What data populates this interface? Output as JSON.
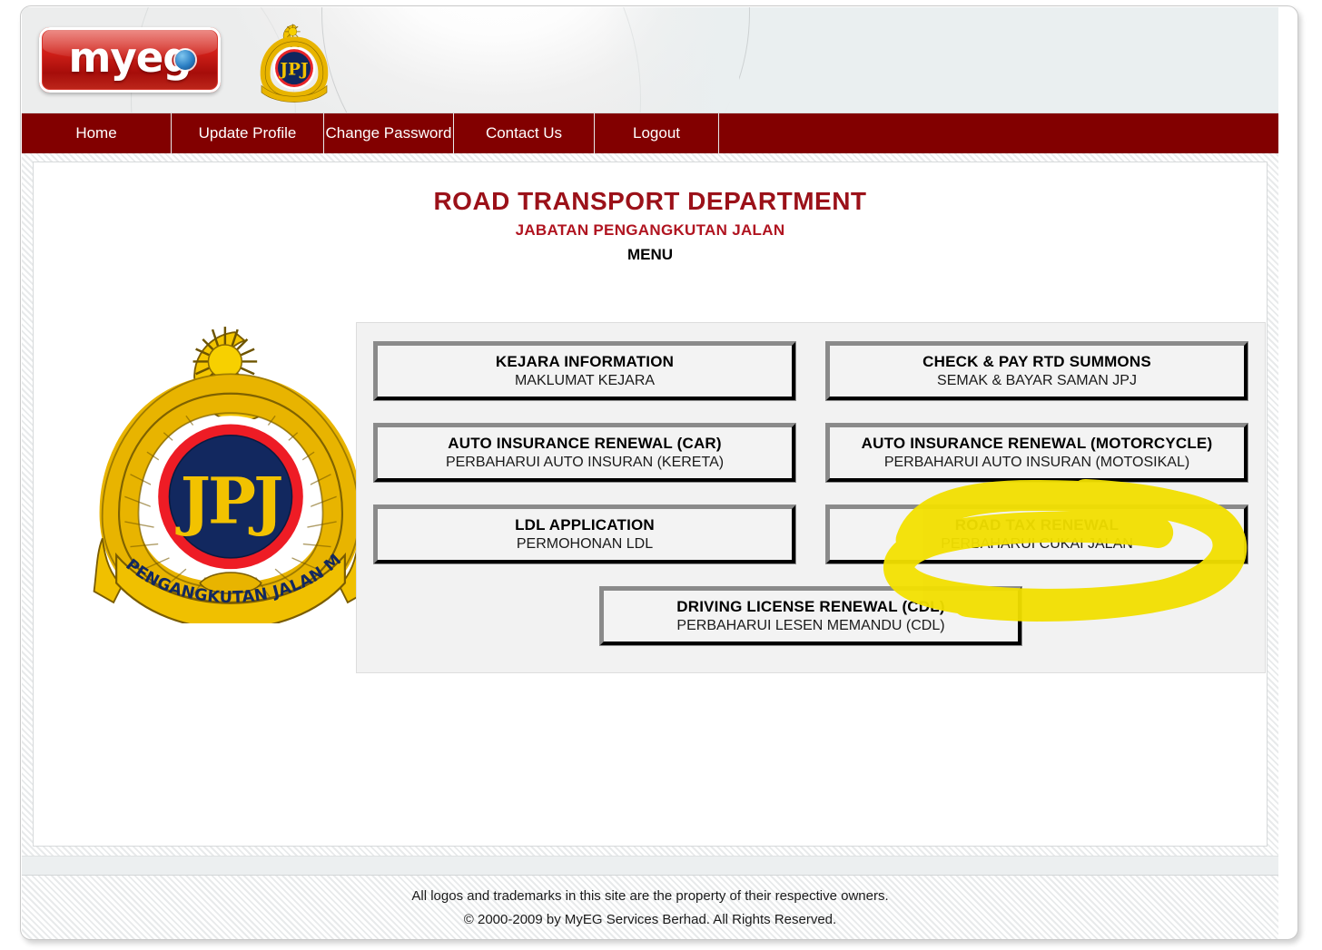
{
  "brand": {
    "logo_text": "myeg",
    "logo_alt": "myeg-logo",
    "crest_alt": "jpj-crest"
  },
  "nav": {
    "items": [
      {
        "label": "Home"
      },
      {
        "label": "Update Profile"
      },
      {
        "label": "Change Password"
      },
      {
        "label": "Contact Us"
      },
      {
        "label": "Logout"
      }
    ]
  },
  "page": {
    "title_en": "ROAD TRANSPORT DEPARTMENT",
    "title_ms": "JABATAN PENGANGKUTAN JALAN",
    "section_label": "MENU"
  },
  "crest": {
    "ribbon_text": "JABATAN PENGANGKUTAN JALAN MALAYSIA",
    "monogram": "JPJ"
  },
  "menu": {
    "buttons": [
      {
        "en": "KEJARA INFORMATION",
        "ms": "MAKLUMAT KEJARA"
      },
      {
        "en": "CHECK & PAY RTD SUMMONS",
        "ms": "SEMAK & BAYAR SAMAN JPJ"
      },
      {
        "en": "AUTO INSURANCE RENEWAL (CAR)",
        "ms": "PERBAHARUI AUTO INSURAN (KERETA)"
      },
      {
        "en": "AUTO INSURANCE RENEWAL (MOTORCYCLE)",
        "ms": "PERBAHARUI AUTO INSURAN (MOTOSIKAL)"
      },
      {
        "en": "LDL APPLICATION",
        "ms": "PERMOHONAN LDL"
      },
      {
        "en": "ROAD TAX RENEWAL",
        "ms": "PERBAHARUI CUKAI JALAN"
      },
      {
        "en": "DRIVING LICENSE RENEWAL (CDL)",
        "ms": "PERBAHARUI LESEN MEMANDU (CDL)"
      }
    ],
    "highlighted_index": 5
  },
  "annotation": {
    "type": "highlighter-circle",
    "color": "#f2e000",
    "target": "ROAD TAX RENEWAL"
  },
  "footer": {
    "line1": "All logos and trademarks in this site are the property of their respective owners.",
    "line2": "© 2000-2009 by MyEG Services Berhad. All Rights Reserved."
  },
  "colors": {
    "nav_bar": "#820000",
    "title_red": "#9b1119",
    "subtitle_red": "#b01420",
    "highlight_yellow": "#f2e000",
    "panel_gray": "#f2f2f2"
  }
}
